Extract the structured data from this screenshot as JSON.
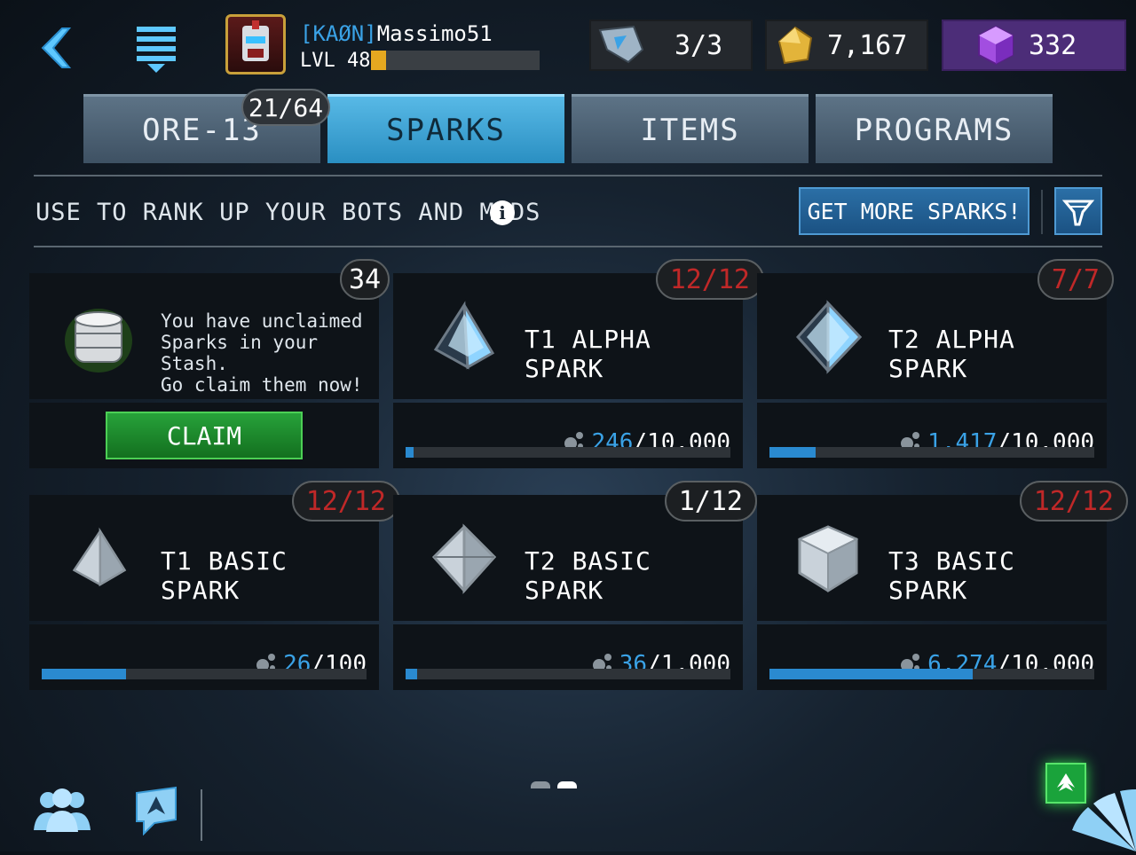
{
  "header": {
    "clan_tag": "[KAØN]",
    "player_name": "Massimo51",
    "level_label": "LVL 48",
    "xp_progress": 0.09,
    "energy": "3/3",
    "gold": "7,167",
    "gems": "332"
  },
  "tabs": [
    {
      "label": "ORE-13",
      "active": false,
      "badge": "21/64"
    },
    {
      "label": "SPARKS",
      "active": true
    },
    {
      "label": "ITEMS",
      "active": false
    },
    {
      "label": "PROGRAMS",
      "active": false
    }
  ],
  "toolbar": {
    "hint": "USE TO RANK UP YOUR BOTS AND MODS",
    "get_more_label": "GET MORE SPARKS!"
  },
  "stash": {
    "badge": "34",
    "line1": "You have unclaimed",
    "line2": "Sparks in your Stash.",
    "line3": "Go claim them now!",
    "claim_label": "CLAIM"
  },
  "cards": [
    {
      "title": "T1 ALPHA SPARK",
      "badge": "12/12",
      "badge_color": "red",
      "current": "246",
      "total": "10,000",
      "progress": 0.025
    },
    {
      "title": "T2 ALPHA SPARK",
      "badge": "7/7",
      "badge_color": "red",
      "current": "1,417",
      "total": "10,000",
      "progress": 0.142
    },
    {
      "title": "T1 BASIC SPARK",
      "badge": "12/12",
      "badge_color": "red",
      "current": "26",
      "total": "100",
      "progress": 0.26
    },
    {
      "title": "T2 BASIC SPARK",
      "badge": "1/12",
      "badge_color": "white",
      "current": "36",
      "total": "1,000",
      "progress": 0.036
    },
    {
      "title": "T3 BASIC SPARK",
      "badge": "12/12",
      "badge_color": "red",
      "current": "6,274",
      "total": "10,000",
      "progress": 0.627
    }
  ],
  "colors": {
    "accent_blue": "#3aa2e6",
    "badge_red": "#c02828",
    "claim_green": "#1f8f2f",
    "gem_purple": "#4c2d78"
  }
}
